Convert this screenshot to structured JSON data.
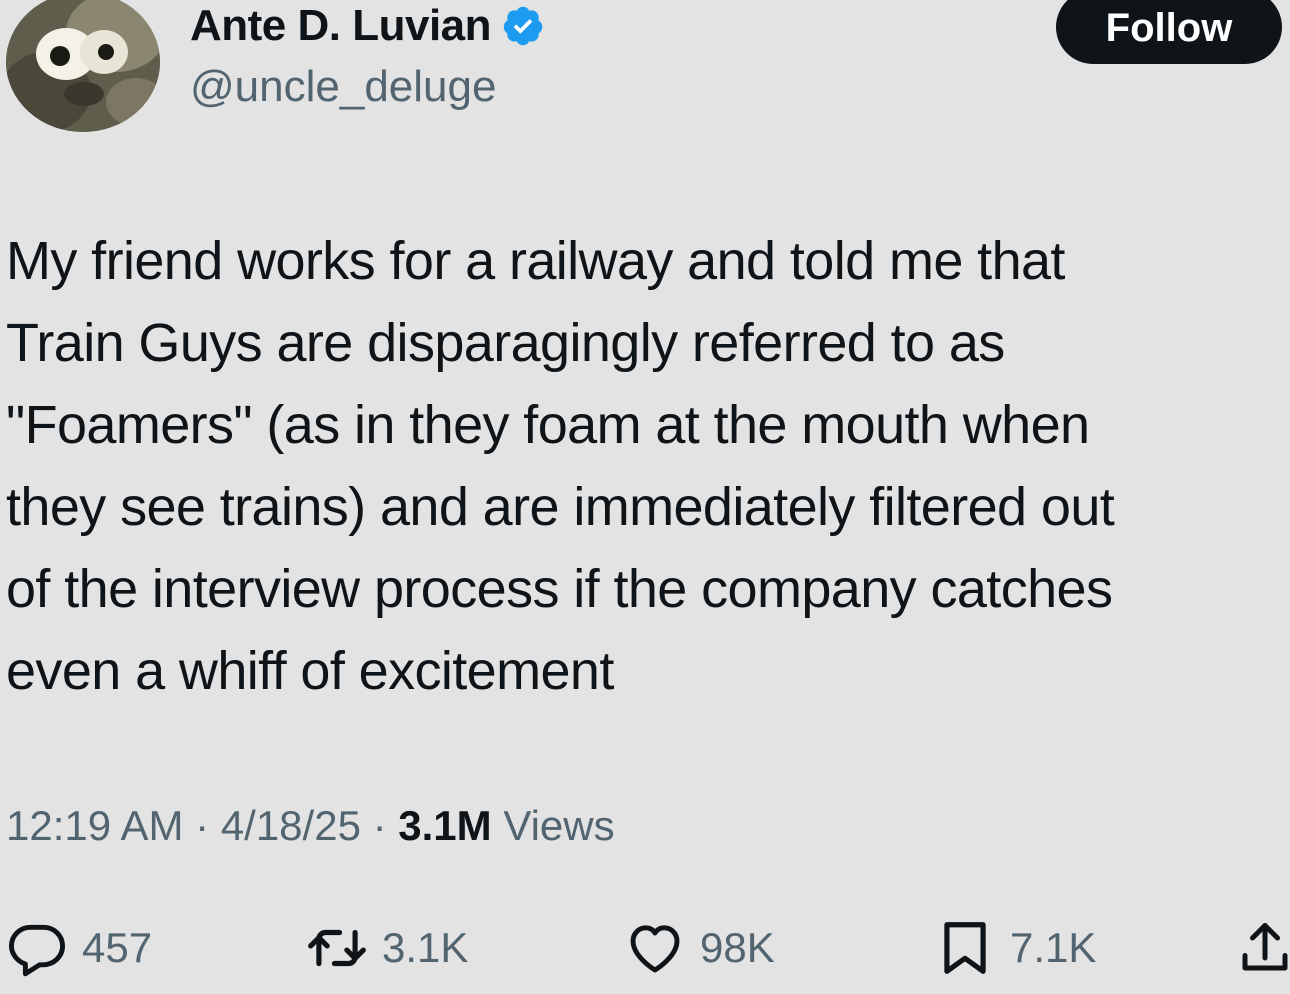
{
  "author": {
    "display_name": "Ante D. Luvian",
    "handle": "@uncle_deluge",
    "verified": true,
    "avatar_icon": "avatar-image"
  },
  "follow_label": "Follow",
  "tweet": {
    "lines": [
      "My friend works for a railway and told me that",
      "Train Guys are disparagingly referred to as",
      "\"Foamers\" (as in they foam at the mouth when",
      "they see trains) and are immediately filtered out",
      "of the interview process if the company catches",
      "even a whiff of excitement"
    ]
  },
  "meta": {
    "time": "12:19 AM",
    "separator": " · ",
    "date": "4/18/25",
    "views_count": "3.1M",
    "views_label": "Views"
  },
  "actions": {
    "replies": "457",
    "reposts": "3.1K",
    "likes": "98K",
    "bookmarks": "7.1K"
  },
  "colors": {
    "background": "#e3e3e3",
    "text": "#0f1419",
    "secondary": "#536471",
    "verified": "#1d9bf0",
    "button": "#0f1419"
  }
}
